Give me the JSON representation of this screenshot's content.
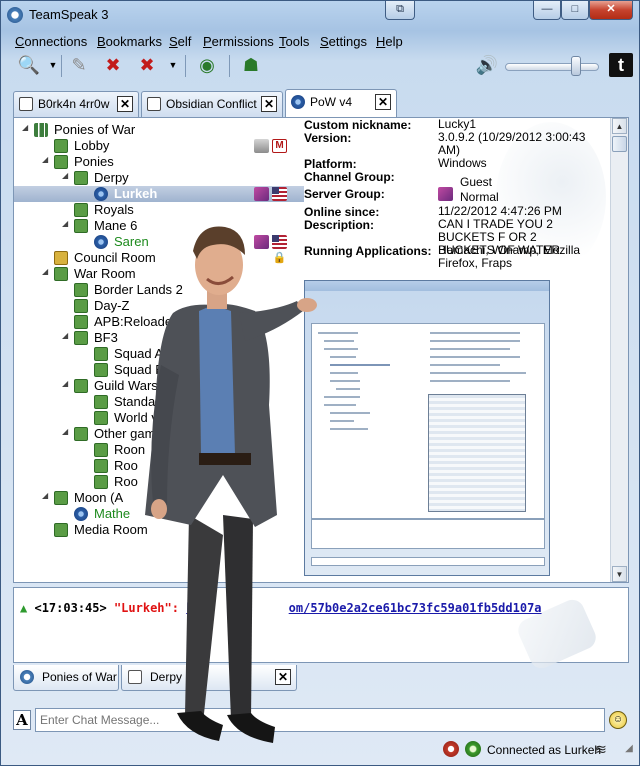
{
  "window": {
    "title": "TeamSpeak 3",
    "controls": [
      "minimize-label",
      "maximize-label",
      "close-label"
    ],
    "control_glyphs": {
      "minimize": "—",
      "maximize": "□",
      "close": "✕",
      "restore": "⧉"
    }
  },
  "menu": [
    "Connections",
    "Bookmarks",
    "Self",
    "Permissions",
    "Tools",
    "Settings",
    "Help"
  ],
  "toolbar": {
    "icons": [
      "connect-icon",
      "bookmark-icon",
      "mute-mic-icon",
      "mute-speakers-icon",
      "away-icon",
      "subscribe-icon"
    ],
    "volume_level": 0.75,
    "logo_letter": "t"
  },
  "server_tabs": [
    {
      "label": "B0rk4n 4rr0w"
    },
    {
      "label": "Obsidian Conflict"
    },
    {
      "label": "PoW v4"
    }
  ],
  "tree": [
    {
      "label": "Ponies of War",
      "type": "server",
      "depth": 0
    },
    {
      "label": "Lobby",
      "type": "channel",
      "depth": 1
    },
    {
      "label": "Ponies",
      "type": "channel",
      "depth": 1
    },
    {
      "label": "Derpy",
      "type": "channel",
      "depth": 2
    },
    {
      "label": "Lurkeh",
      "type": "user",
      "depth": 3,
      "selected": true
    },
    {
      "label": "Royals",
      "type": "channel",
      "depth": 2
    },
    {
      "label": "Mane 6",
      "type": "channel",
      "depth": 2
    },
    {
      "label": "Saren",
      "type": "user",
      "depth": 3
    },
    {
      "label": "Council Room",
      "type": "channel-y",
      "depth": 1
    },
    {
      "label": "War Room",
      "type": "channel",
      "depth": 1
    },
    {
      "label": "Border Lands 2",
      "type": "channel",
      "depth": 2
    },
    {
      "label": "Day-Z",
      "type": "channel",
      "depth": 2
    },
    {
      "label": "APB:Reloaded",
      "type": "channel",
      "depth": 2
    },
    {
      "label": "BF3",
      "type": "channel",
      "depth": 2
    },
    {
      "label": "Squad A",
      "type": "channel",
      "depth": 3
    },
    {
      "label": "Squad B",
      "type": "channel",
      "depth": 3
    },
    {
      "label": "Guild Wars 2",
      "type": "channel",
      "depth": 2
    },
    {
      "label": "Standar",
      "type": "channel",
      "depth": 3
    },
    {
      "label": "World v",
      "type": "channel",
      "depth": 3
    },
    {
      "label": "Other gam",
      "type": "channel",
      "depth": 2
    },
    {
      "label": "Roon",
      "type": "channel",
      "depth": 3
    },
    {
      "label": "Roo",
      "type": "channel",
      "depth": 3
    },
    {
      "label": "Roo",
      "type": "channel",
      "depth": 3
    },
    {
      "label": "Moon (A",
      "type": "channel",
      "depth": 1
    },
    {
      "label": "Mathe",
      "type": "user",
      "depth": 2
    },
    {
      "label": "Media Room",
      "type": "channel",
      "depth": 1
    }
  ],
  "client_info": [
    {
      "key": "Custom nickname:",
      "value": "Lucky1"
    },
    {
      "key": "Version:",
      "value": "3.0.9.2 (10/29/2012 3:00:43 AM)"
    },
    {
      "key": "Platform:",
      "value": "Windows"
    },
    {
      "key": "Channel Group:",
      "value": "Guest"
    },
    {
      "key": "Server Group:",
      "value": "Normal"
    },
    {
      "key": "Online since:",
      "value": "11/22/2012 4:47:26 PM"
    },
    {
      "key": "Description:",
      "value": "CAN I TRADE YOU 2 BUCKETS F OR 2 BUCKETS OF WATER"
    },
    {
      "key": "Running Applications:",
      "value": "Hamachi, Winamp, Mozilla Firefox, Fraps"
    }
  ],
  "chat": {
    "time": "<17:03:45>",
    "name": "\"Lurkeh\":",
    "link": "http://gyazo.com/57b0e2a2ce61bc73fc59a01fb5dd107a",
    "link_visible_start": "ht",
    "link_visible_end": "om/57b0e2a2ce61bc73fc59a01fb5dd107a"
  },
  "chat_tabs": [
    {
      "label": "Ponies of War"
    },
    {
      "label": "Derpy"
    }
  ],
  "chat_input": {
    "placeholder": "Enter Chat Message..."
  },
  "status": {
    "text": "Connected as Lurkeh"
  }
}
